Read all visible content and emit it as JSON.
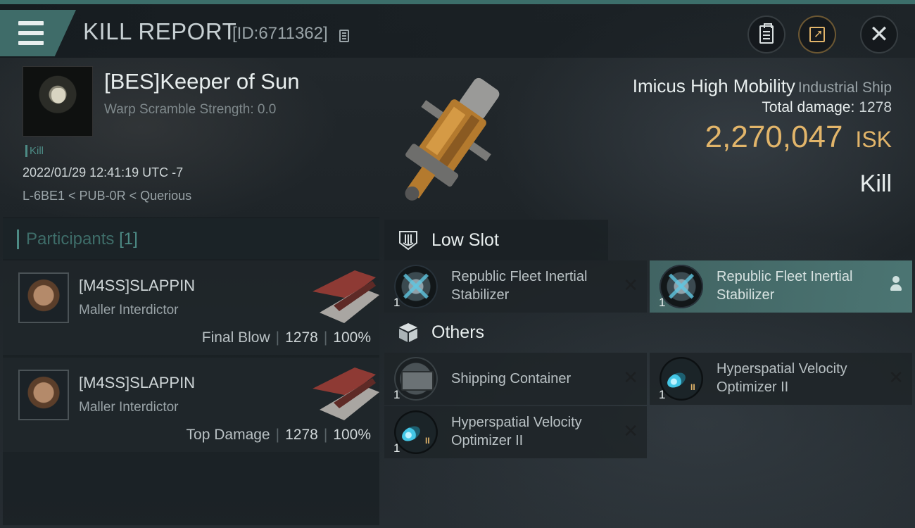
{
  "header": {
    "title": "KILL REPORT",
    "report_id": "[ID:6711362]"
  },
  "victim": {
    "name": "[BES]Keeper of Sun",
    "warp_scramble": "Warp Scramble Strength: 0.0",
    "kill_tag": "Kill",
    "datetime": "2022/01/29 12:41:19 UTC -7",
    "location": "L-6BE1 < PUB-0R < Querious"
  },
  "ship": {
    "name": "Imicus High Mobility",
    "class": "Industrial Ship",
    "total_damage_label": "Total damage:",
    "total_damage": "1278",
    "isk_value": "2,270,047",
    "isk_unit": "ISK",
    "result": "Kill"
  },
  "participants": {
    "label": "Participants",
    "count": "[1]",
    "rows": [
      {
        "name": "[M4SS]SLAPPIN",
        "ship": "Maller Interdictor",
        "role": "Final Blow",
        "damage": "1278",
        "percent": "100%"
      },
      {
        "name": "[M4SS]SLAPPIN",
        "ship": "Maller Interdictor",
        "role": "Top Damage",
        "damage": "1278",
        "percent": "100%"
      }
    ],
    "separator": "|"
  },
  "sections": {
    "low_slot": "Low Slot",
    "others": "Others"
  },
  "items": {
    "low": [
      {
        "qty": "1",
        "line1": "Republic Fleet Inertial",
        "line2": "Stabilizer",
        "status": "destroyed"
      },
      {
        "qty": "1",
        "line1": "Republic Fleet Inertial",
        "line2": "Stabilizer",
        "status": "dropped"
      }
    ],
    "others": [
      {
        "qty": "1",
        "line1": "Shipping Container",
        "status": "destroyed"
      },
      {
        "qty": "1",
        "line1": "Hyperspatial Velocity",
        "line2": "Optimizer II",
        "status": "destroyed"
      },
      {
        "qty": "1",
        "line1": "Hyperspatial Velocity",
        "line2": "Optimizer II",
        "status": "destroyed"
      }
    ],
    "x_glyph": "✕"
  },
  "colors": {
    "accent": "#3f6c69",
    "isk": "#e2b56a",
    "background": "#23292d"
  }
}
